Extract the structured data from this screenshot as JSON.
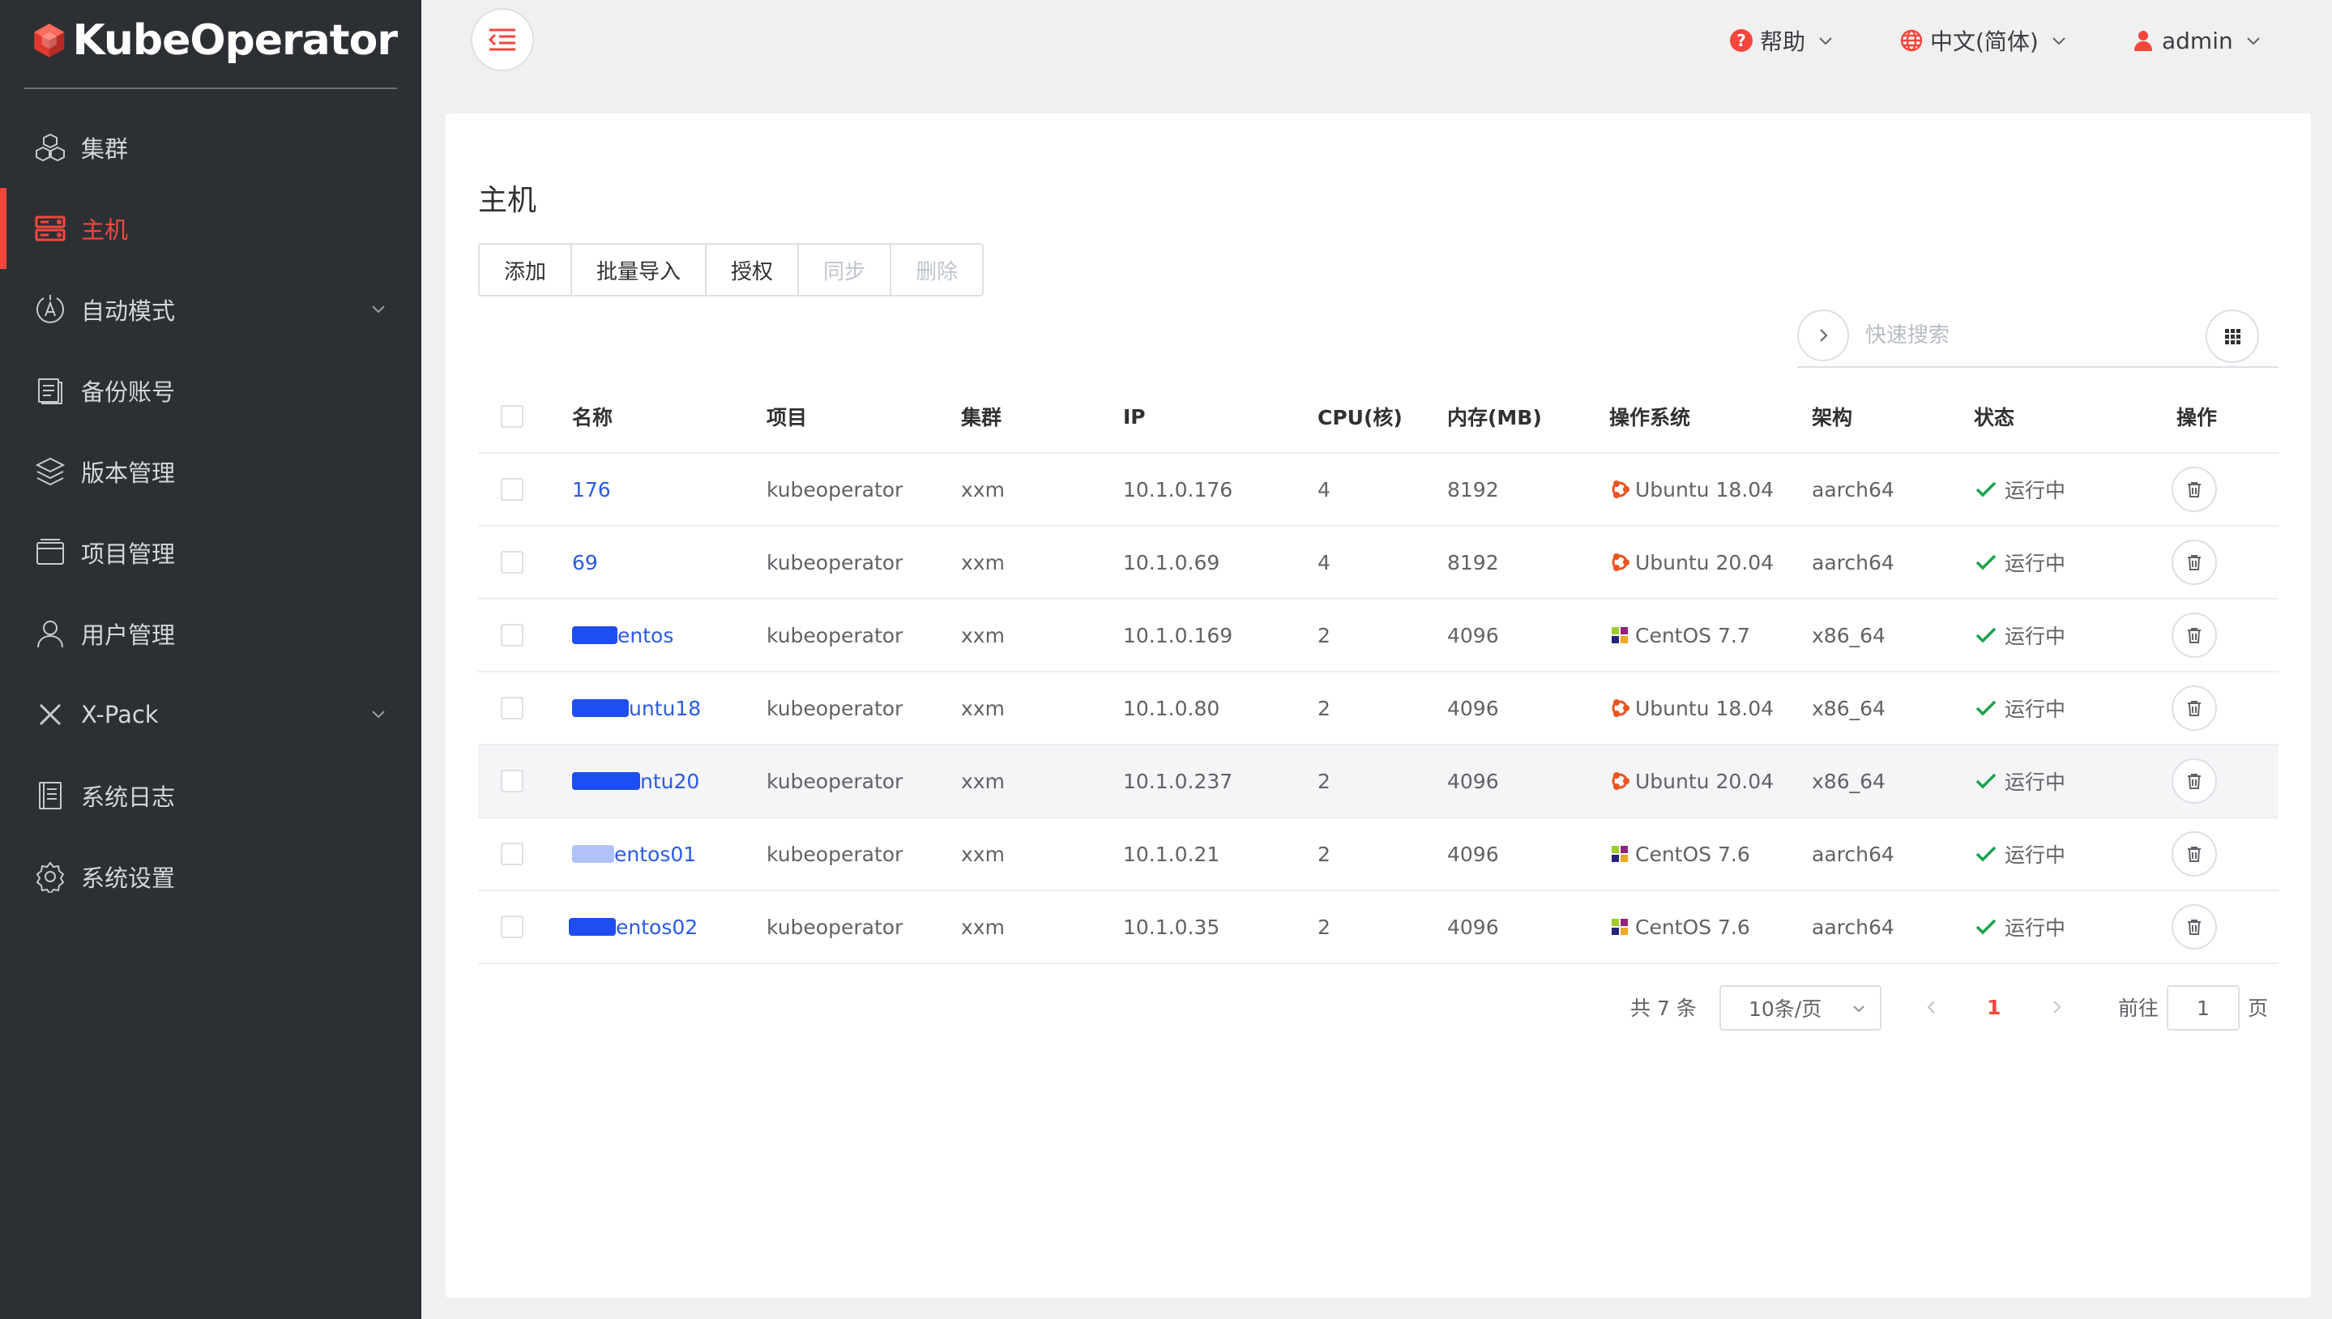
{
  "app": {
    "logo_text": "KubeOperator",
    "brand_color": "#f5463c"
  },
  "sidebar": {
    "items": [
      {
        "label": "集群",
        "icon": "cubes-icon",
        "active": false,
        "has_children": false
      },
      {
        "label": "主机",
        "icon": "server-icon",
        "active": true,
        "has_children": false
      },
      {
        "label": "自动模式",
        "icon": "auto-mode-icon",
        "active": false,
        "has_children": true
      },
      {
        "label": "备份账号",
        "icon": "backup-icon",
        "active": false,
        "has_children": false
      },
      {
        "label": "版本管理",
        "icon": "layers-icon",
        "active": false,
        "has_children": false
      },
      {
        "label": "项目管理",
        "icon": "folder-icon",
        "active": false,
        "has_children": false
      },
      {
        "label": "用户管理",
        "icon": "user-icon",
        "active": false,
        "has_children": false
      },
      {
        "label": "X-Pack",
        "icon": "x-icon",
        "active": false,
        "has_children": true
      },
      {
        "label": "系统日志",
        "icon": "log-icon",
        "active": false,
        "has_children": false
      },
      {
        "label": "系统设置",
        "icon": "gear-icon",
        "active": false,
        "has_children": false
      }
    ]
  },
  "header": {
    "help_label": "帮助",
    "language_label": "中文(简体)",
    "user_label": "admin"
  },
  "page": {
    "title": "主机"
  },
  "toolbar": {
    "add": "添加",
    "batch_import": "批量导入",
    "authorize": "授权",
    "sync": "同步",
    "delete": "删除"
  },
  "search": {
    "placeholder": "快速搜索"
  },
  "table": {
    "columns": {
      "name": "名称",
      "project": "项目",
      "cluster": "集群",
      "ip": "IP",
      "cpu": "CPU(核)",
      "memory": "内存(MB)",
      "os": "操作系统",
      "arch": "架构",
      "status": "状态",
      "actions": "操作"
    },
    "rows": [
      {
        "name": "176",
        "project": "kubeoperator",
        "cluster": "xxm",
        "ip": "10.1.0.176",
        "cpu": "4",
        "memory": "8192",
        "os": "Ubuntu 18.04",
        "os_icon": "ubuntu-icon",
        "arch": "aarch64",
        "status": "运行中"
      },
      {
        "name": "69",
        "project": "kubeoperator",
        "cluster": "xxm",
        "ip": "10.1.0.69",
        "cpu": "4",
        "memory": "8192",
        "os": "Ubuntu 20.04",
        "os_icon": "ubuntu-icon",
        "arch": "aarch64",
        "status": "运行中"
      },
      {
        "name": "entos",
        "project": "kubeoperator",
        "cluster": "xxm",
        "ip": "10.1.0.169",
        "cpu": "2",
        "memory": "4096",
        "os": "CentOS 7.7",
        "os_icon": "centos-icon",
        "arch": "x86_64",
        "status": "运行中"
      },
      {
        "name": "untu18",
        "project": "kubeoperator",
        "cluster": "xxm",
        "ip": "10.1.0.80",
        "cpu": "2",
        "memory": "4096",
        "os": "Ubuntu 18.04",
        "os_icon": "ubuntu-icon",
        "arch": "x86_64",
        "status": "运行中"
      },
      {
        "name": "ntu20",
        "project": "kubeoperator",
        "cluster": "xxm",
        "ip": "10.1.0.237",
        "cpu": "2",
        "memory": "4096",
        "os": "Ubuntu 20.04",
        "os_icon": "ubuntu-icon",
        "arch": "x86_64",
        "status": "运行中"
      },
      {
        "name": "entos01",
        "project": "kubeoperator",
        "cluster": "xxm",
        "ip": "10.1.0.21",
        "cpu": "2",
        "memory": "4096",
        "os": "CentOS 7.6",
        "os_icon": "centos-icon",
        "arch": "aarch64",
        "status": "运行中"
      },
      {
        "name": "entos02",
        "project": "kubeoperator",
        "cluster": "xxm",
        "ip": "10.1.0.35",
        "cpu": "2",
        "memory": "4096",
        "os": "CentOS 7.6",
        "os_icon": "centos-icon",
        "arch": "aarch64",
        "status": "运行中"
      }
    ]
  },
  "pagination": {
    "total_label": "共 7 条",
    "page_size": "10条/页",
    "current_page": "1",
    "goto_label": "前往",
    "goto_value": "1",
    "page_suffix": "页"
  }
}
